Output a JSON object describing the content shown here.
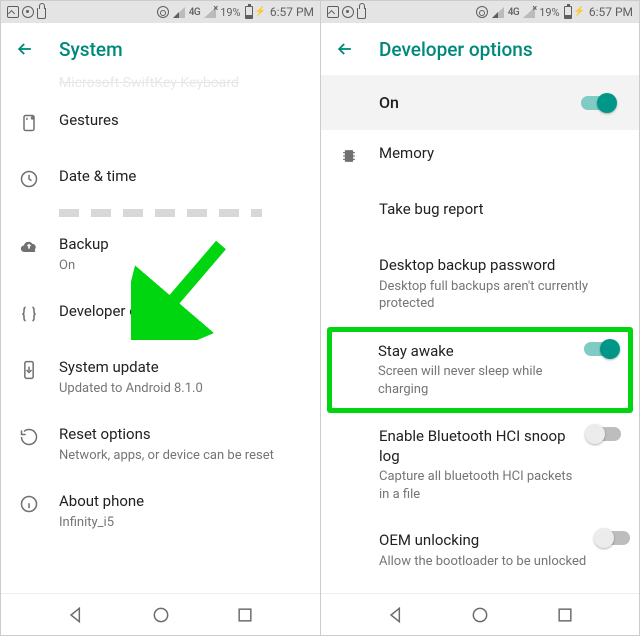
{
  "status": {
    "battery_pct": "19%",
    "time": "6:57 PM",
    "net_label": "4G"
  },
  "left": {
    "header_title": "System",
    "cut_off_top": "Microsoft SwiftKey Keyboard",
    "items": [
      {
        "title": "Gestures",
        "sub": ""
      },
      {
        "title": "Date & time",
        "sub": ""
      },
      {
        "title": "Backup",
        "sub": "On"
      },
      {
        "title": "Developer options",
        "sub": ""
      },
      {
        "title": "System update",
        "sub": "Updated to Android 8.1.0"
      },
      {
        "title": "Reset options",
        "sub": "Network, apps, or device can be reset"
      },
      {
        "title": "About phone",
        "sub": "Infinity_i5"
      }
    ]
  },
  "right": {
    "header_title": "Developer options",
    "master_on_label": "On",
    "items": [
      {
        "title": "Memory",
        "sub": ""
      },
      {
        "title": "Take bug report",
        "sub": ""
      },
      {
        "title": "Desktop backup password",
        "sub": "Desktop full backups aren't currently protected"
      },
      {
        "title": "Stay awake",
        "sub": "Screen will never sleep while charging",
        "toggle": "on"
      },
      {
        "title": "Enable Bluetooth HCI snoop log",
        "sub": "Capture all bluetooth HCI packets in a file",
        "toggle": "off"
      },
      {
        "title": "OEM unlocking",
        "sub": "Allow the bootloader to be unlocked",
        "toggle": "off"
      }
    ]
  }
}
